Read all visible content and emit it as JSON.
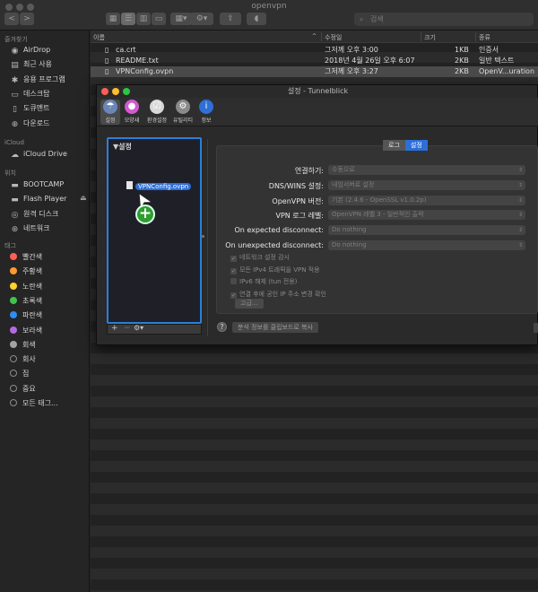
{
  "finder": {
    "window_title": "openvpn",
    "search_placeholder": "검색",
    "nav_back": "<",
    "nav_forward": ">",
    "columns": {
      "name": "이름",
      "modified": "수정일",
      "size": "크기",
      "kind": "종류"
    },
    "files": [
      {
        "name": "ca.crt",
        "modified": "그저께 오후 3:00",
        "size": "1KB",
        "kind": "인증서"
      },
      {
        "name": "README.txt",
        "modified": "2018년 4월 26일 오후 6:07",
        "size": "2KB",
        "kind": "일반 텍스트"
      },
      {
        "name": "VPNConfig.ovpn",
        "modified": "그저께 오후 3:27",
        "size": "2KB",
        "kind": "OpenV...uration"
      }
    ]
  },
  "sidebar": {
    "favorites_header": "즐겨찾기",
    "favorites": [
      {
        "label": "AirDrop",
        "icon": "airdrop-icon",
        "glyph": "◉"
      },
      {
        "label": "최근 사용",
        "icon": "recents-icon",
        "glyph": "▤"
      },
      {
        "label": "응용 프로그램",
        "icon": "applications-icon",
        "glyph": "✱"
      },
      {
        "label": "데스크탑",
        "icon": "desktop-icon",
        "glyph": "▭"
      },
      {
        "label": "도큐멘트",
        "icon": "documents-icon",
        "glyph": "▯"
      },
      {
        "label": "다운로드",
        "icon": "downloads-icon",
        "glyph": "⊕"
      }
    ],
    "icloud_header": "iCloud",
    "icloud": [
      {
        "label": "iCloud Drive",
        "icon": "cloud-icon",
        "glyph": "☁"
      }
    ],
    "locations_header": "위치",
    "locations": [
      {
        "label": "BOOTCAMP",
        "icon": "drive-icon",
        "glyph": "▬"
      },
      {
        "label": "Flash Player",
        "icon": "drive-icon",
        "glyph": "▬"
      },
      {
        "label": "원격 디스크",
        "icon": "remote-disc-icon",
        "glyph": "◎"
      },
      {
        "label": "네트워크",
        "icon": "network-icon",
        "glyph": "⊛"
      }
    ],
    "eject_glyph": "⏏",
    "tags_header": "태그",
    "tags": [
      {
        "label": "빨간색",
        "color": "#ff5e57"
      },
      {
        "label": "주황색",
        "color": "#ff9a2e"
      },
      {
        "label": "노란색",
        "color": "#ffd02e"
      },
      {
        "label": "초록색",
        "color": "#3fc54a"
      },
      {
        "label": "파란색",
        "color": "#2f8df5"
      },
      {
        "label": "보라색",
        "color": "#b36ae2"
      },
      {
        "label": "회색",
        "color": "#a3a3a3"
      }
    ],
    "tags_extra": [
      {
        "label": "회사"
      },
      {
        "label": "집"
      },
      {
        "label": "중요"
      },
      {
        "label": "모든 태그..."
      }
    ]
  },
  "tunnelblick": {
    "title": "설정 - Tunnelblick",
    "toolbar": [
      {
        "label": "설정",
        "icon": "configurations-icon",
        "glyph": "☂",
        "color": "#6a86b8"
      },
      {
        "label": "모양새",
        "icon": "appearance-icon",
        "glyph": "●",
        "color": "#d05bd0"
      },
      {
        "label": "환경설정",
        "icon": "preferences-icon",
        "glyph": "☑",
        "color": "#d8d8d8"
      },
      {
        "label": "유틸리티",
        "icon": "utilities-icon",
        "glyph": "⚙",
        "color": "#8a8a8a"
      },
      {
        "label": "정보",
        "icon": "info-icon",
        "glyph": "i",
        "color": "#2f6fd6"
      }
    ],
    "config_header": "▼설정",
    "dragged_file": "VPNConfig.ovpn",
    "drag_badge": "+",
    "cursor_glyph": "➤",
    "list_buttons": {
      "add": "+",
      "remove": "−",
      "gear": "⚙▾"
    },
    "tabs": {
      "log": "로그",
      "settings": "설정"
    },
    "rows": [
      {
        "label": "연결하기:",
        "value": "수동으로"
      },
      {
        "label": "DNS/WINS 설정:",
        "value": "내임서버로 설정"
      },
      {
        "label": "OpenVPN 버전:",
        "value": "기본 (2.4.6 - OpenSSL v1.0.2p)"
      },
      {
        "label": "VPN 로그 레벨:",
        "value": "OpenVPN 레벨 3 - 일반적인 출력"
      },
      {
        "label": "On expected disconnect:",
        "value": "Do nothing"
      },
      {
        "label": "On unexpected disconnect:",
        "value": "Do nothing"
      }
    ],
    "checkboxes": [
      {
        "label": "네트워크 설정 감시",
        "checked": true
      },
      {
        "label": "모든 IPv4 트래픽을 VPN 적용",
        "checked": true
      },
      {
        "label": "IPv6 해제 (tun 전용)",
        "checked": false
      },
      {
        "label": "연결 후에 공인 IP 주소 변경 확인",
        "checked": true
      }
    ],
    "advanced_button": "고급...",
    "help_glyph": "?",
    "copy_button": "분석 정보를 클립보드로 복사"
  }
}
